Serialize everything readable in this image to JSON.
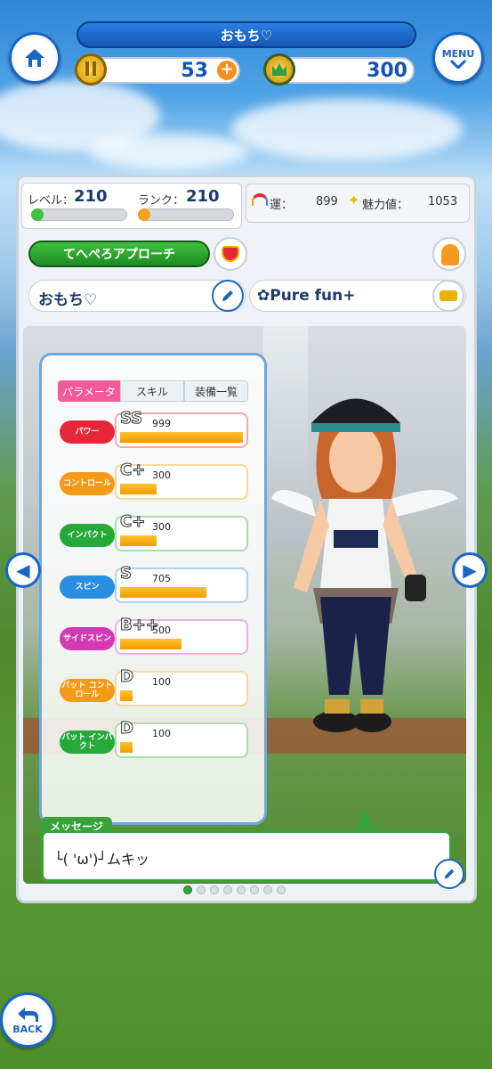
{
  "header": {
    "player_name": "おもち♡",
    "menu_label": "MENU",
    "coins": "53",
    "gems": "300"
  },
  "profile": {
    "level_label": "レベル：",
    "level": "210",
    "rank_label": "ランク：",
    "rank": "210",
    "luck_label": "運：",
    "luck": "899",
    "charm_label": "魅力値：",
    "charm": "1053",
    "title_badge": "てへぺろアプローチ",
    "nickname": "おもち♡",
    "club_name": "✿Pure fun+"
  },
  "params": {
    "tabs": [
      "パラメータ",
      "スキル",
      "装備一覧"
    ],
    "rows": [
      {
        "label": "パワー",
        "grade": "SS",
        "value": "999",
        "fill": 1.0,
        "color": "#e8263a"
      },
      {
        "label": "コントロール",
        "grade": "C+",
        "value": "300",
        "fill": 0.3,
        "color": "#f39a16"
      },
      {
        "label": "インパクト",
        "grade": "C+",
        "value": "300",
        "fill": 0.3,
        "color": "#27a83a"
      },
      {
        "label": "スピン",
        "grade": "S",
        "value": "705",
        "fill": 0.7,
        "color": "#2a8ee0"
      },
      {
        "label": "サイドスピン",
        "grade": "B++",
        "value": "500",
        "fill": 0.5,
        "color": "#d13ab0"
      },
      {
        "label": "バット コントロール",
        "grade": "D",
        "value": "100",
        "fill": 0.1,
        "color": "#f39a16"
      },
      {
        "label": "バット インパクト",
        "grade": "D",
        "value": "100",
        "fill": 0.1,
        "color": "#27a83a"
      }
    ]
  },
  "message": {
    "tag": "メッセージ",
    "text": "└( 'ω')┘ムキッ"
  },
  "pager": {
    "count": 8,
    "active": 1
  },
  "back_label": "BACK"
}
